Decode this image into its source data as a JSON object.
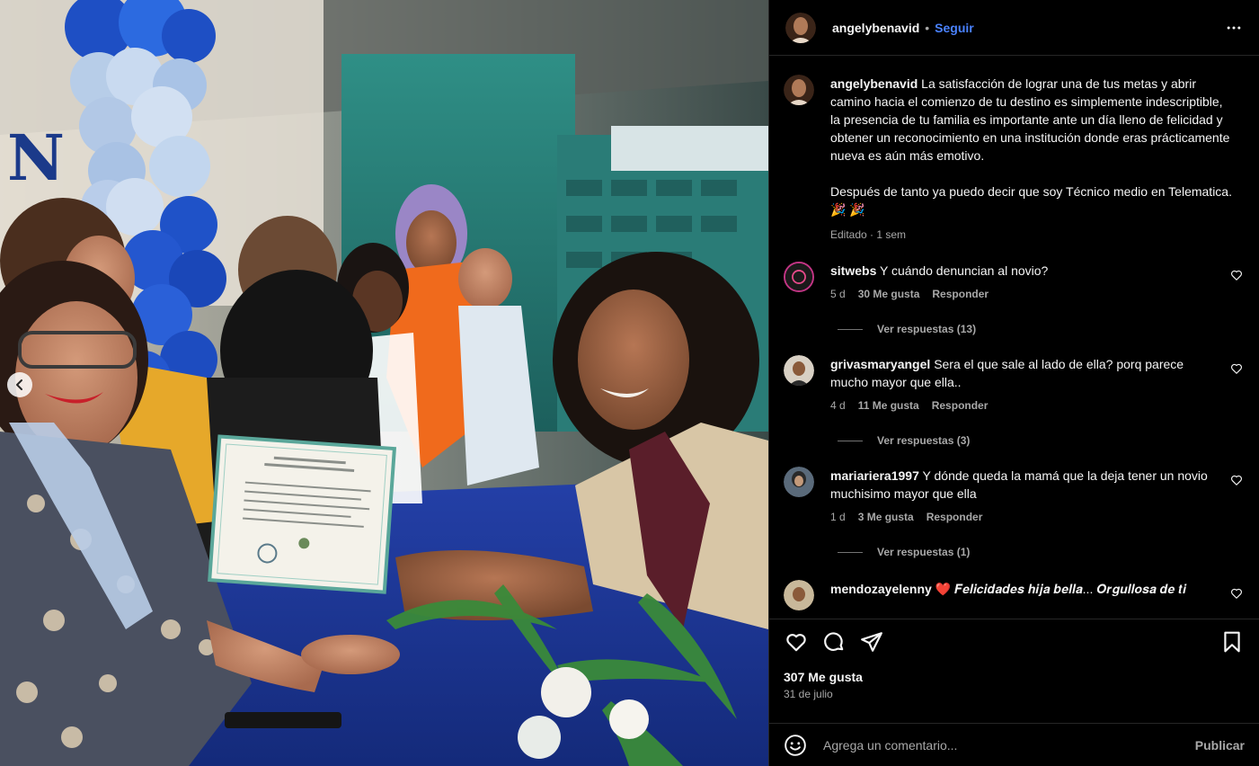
{
  "post": {
    "username": "angelybenavid",
    "separator": "•",
    "follow_label": "Seguir",
    "caption": {
      "para1": "La satisfacción de lograr una de tus metas y abrir camino hacia el comienzo de tu destino es simplemente indescriptible, la presencia de tu familia es importante ante un día lleno de felicidad y obtener un reconocimiento en una institución donde eras prácticamente nueva es aún más emotivo.",
      "para2": "Después de tanto ya puedo decir que soy Técnico medio en Telematica. 🎉 🎉",
      "edited": "Editado · 1 sem"
    },
    "likes": "307 Me gusta",
    "date": "31 de julio",
    "carousel": {
      "count": 5,
      "active_index": 4
    }
  },
  "comments": [
    {
      "user": "sitwebs",
      "text": "Y cuándo denuncian al novio?",
      "time": "5 d",
      "likes": "30 Me gusta",
      "reply": "Responder",
      "view_replies": "Ver respuestas (13)"
    },
    {
      "user": "grivasmaryangel",
      "text": "Sera el que sale al lado de ella? porq parece mucho mayor que ella..",
      "time": "4 d",
      "likes": "11 Me gusta",
      "reply": "Responder",
      "view_replies": "Ver respuestas (3)"
    },
    {
      "user": "mariariera1997",
      "text": "Y dónde queda la mamá que la deja tener un novio muchisimo mayor que ella",
      "time": "1 d",
      "likes": "3 Me gusta",
      "reply": "Responder",
      "view_replies": "Ver respuestas (1)"
    },
    {
      "user": "mendozayelenny",
      "text": "❤️ 𝑭𝒆𝒍𝒊𝒄𝒊𝒅𝒂𝒅𝒆𝒔 𝒉𝒊𝒋𝒂 𝒃𝒆𝒍𝒍𝒂... 𝑶𝒓𝒈𝒖𝒍𝒍𝒐𝒔𝒂 𝒅𝒆 𝒕𝒊"
    }
  ],
  "composer": {
    "placeholder": "Agrega un comentario...",
    "publish_label": "Publicar"
  },
  "icons": {
    "like": "heart-icon",
    "comment": "comment-icon",
    "share": "share-icon",
    "save": "bookmark-icon",
    "more": "more-options-icon",
    "emoji": "emoji-icon",
    "prev": "chevron-left-icon"
  },
  "colors": {
    "background": "#000000",
    "text": "#f5f5f5",
    "muted": "#a8a8a8",
    "link": "#4a82ff",
    "divider": "#262626"
  }
}
